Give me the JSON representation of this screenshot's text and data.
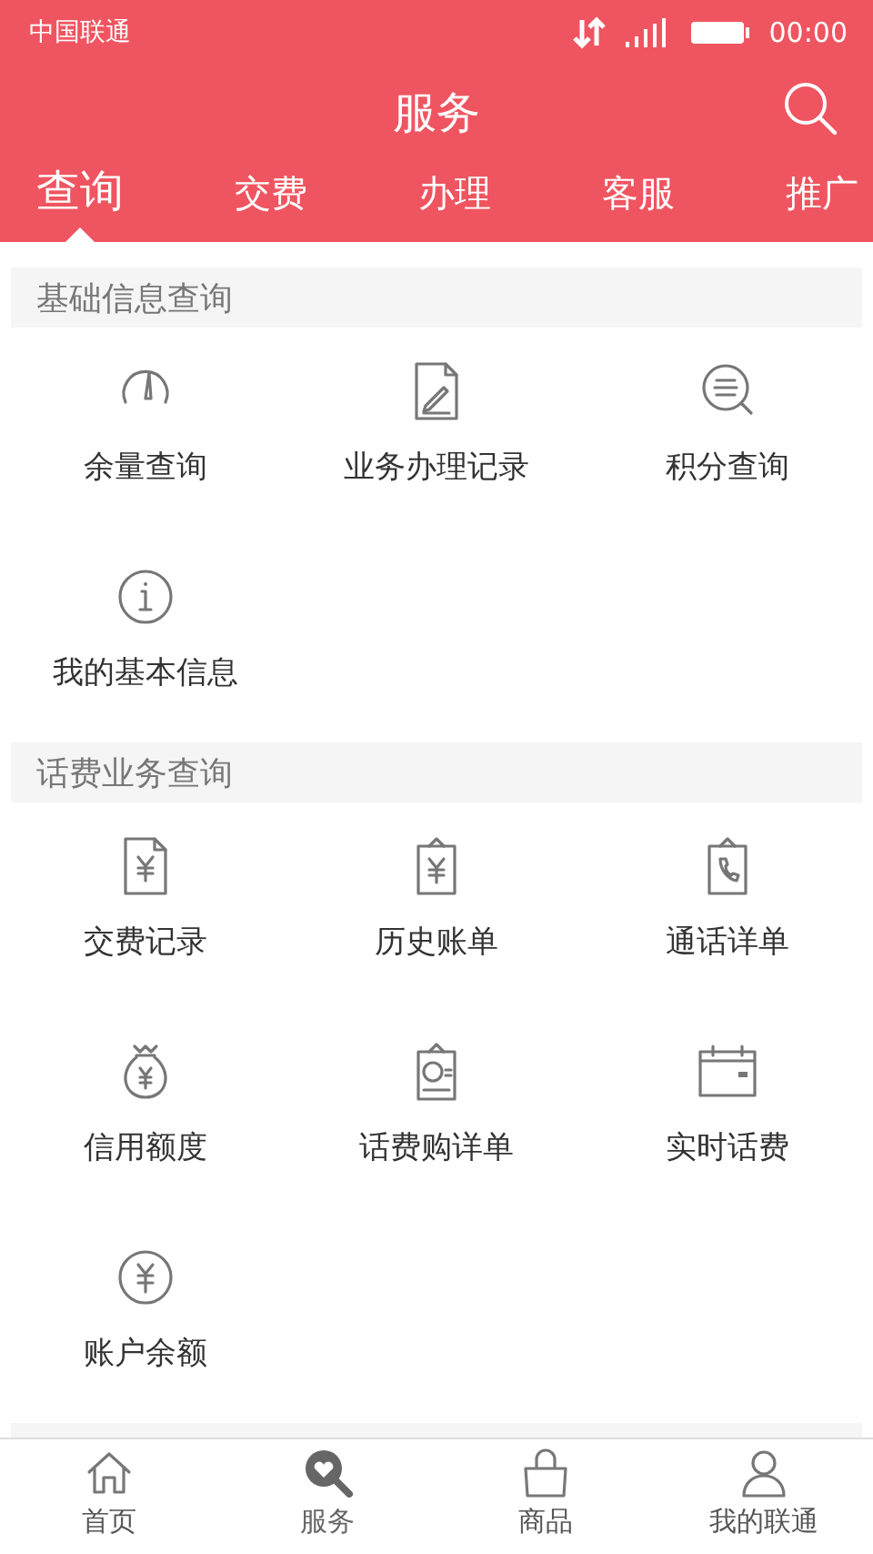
{
  "status_bar": {
    "carrier": "中国联通",
    "time": "00:00"
  },
  "header": {
    "title": "服务"
  },
  "tabs": [
    {
      "label": "查询",
      "selected": true
    },
    {
      "label": "交费",
      "selected": false
    },
    {
      "label": "办理",
      "selected": false
    },
    {
      "label": "客服",
      "selected": false
    },
    {
      "label": "推广",
      "selected": false
    }
  ],
  "sections": [
    {
      "title": "基础信息查询",
      "items": [
        "余量查询",
        "业务办理记录",
        "积分查询",
        "我的基本信息"
      ]
    },
    {
      "title": "话费业务查询",
      "items": [
        "交费记录",
        "历史账单",
        "通话详单",
        "信用额度",
        "话费购详单",
        "实时话费",
        "账户余额"
      ]
    }
  ],
  "bottom_nav": [
    {
      "label": "首页",
      "selected": false
    },
    {
      "label": "服务",
      "selected": true
    },
    {
      "label": "商品",
      "selected": false
    },
    {
      "label": "我的联通",
      "selected": false
    }
  ]
}
